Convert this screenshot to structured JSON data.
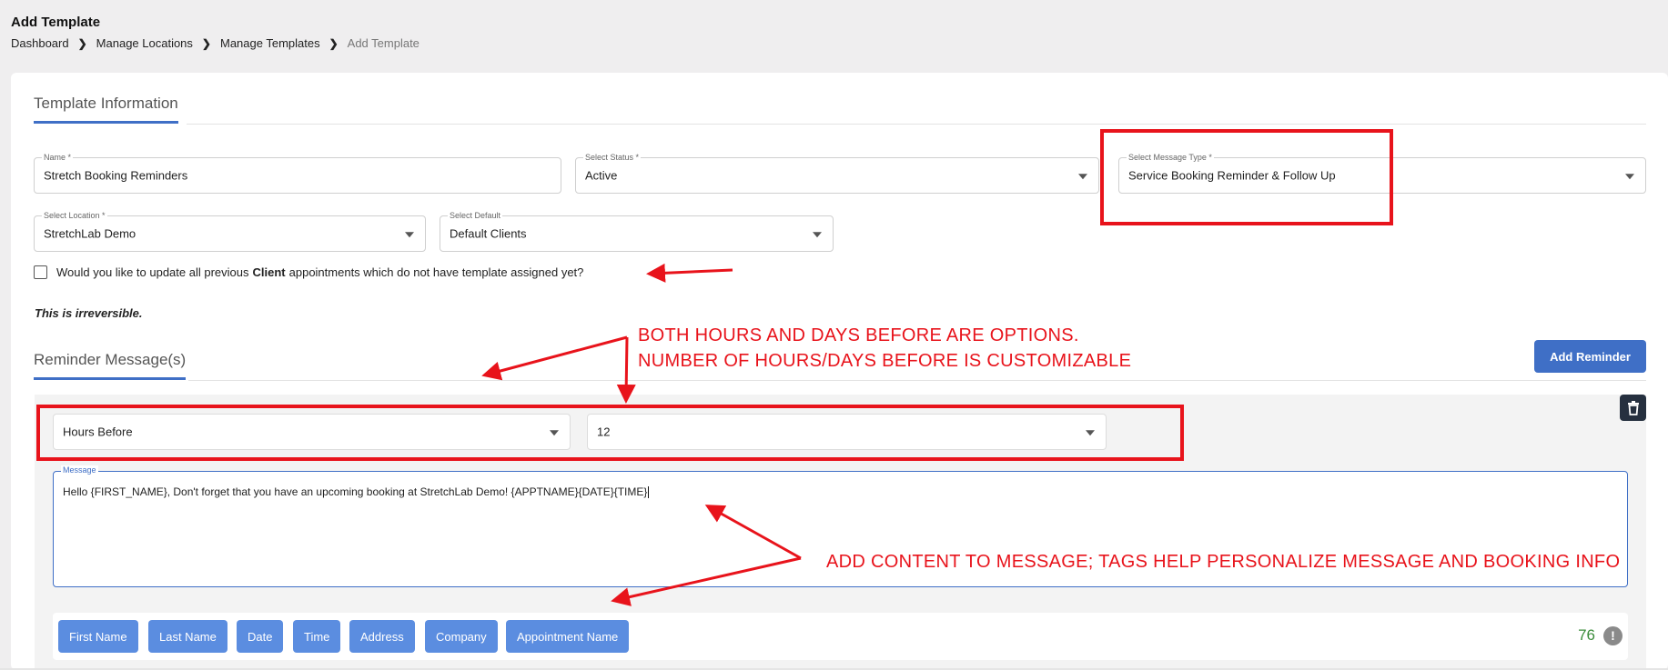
{
  "header": {
    "title": "Add Template",
    "breadcrumb": [
      "Dashboard",
      "Manage Locations",
      "Manage Templates",
      "Add Template"
    ]
  },
  "template_info": {
    "section_title": "Template Information",
    "name": {
      "label": "Name *",
      "value": "Stretch Booking Reminders"
    },
    "status": {
      "label": "Select Status *",
      "value": "Active"
    },
    "message_type": {
      "label": "Select Message Type *",
      "value": "Service Booking Reminder & Follow Up"
    },
    "location": {
      "label": "Select Location *",
      "value": "StretchLab Demo"
    },
    "default": {
      "label": "Select Default",
      "value": "Default Clients"
    },
    "update_checkbox": {
      "text_before": "Would you like to update all previous",
      "bold": "Client",
      "text_after": "appointments which do not have template assigned yet?"
    },
    "irreversible_note": "This is irreversible."
  },
  "reminders": {
    "section_title": "Reminder Message(s)",
    "add_button": "Add Reminder",
    "timing_type": "Hours Before",
    "timing_value": "12",
    "message": {
      "label": "Message",
      "value": "Hello {FIRST_NAME}, Don't forget that you have an upcoming booking at StretchLab Demo!  {APPTNAME}{DATE}{TIME}"
    },
    "tags": [
      "First Name",
      "Last Name",
      "Date",
      "Time",
      "Address",
      "Company",
      "Appointment Name"
    ],
    "char_count": "76",
    "info_icon": "!"
  },
  "annotations": {
    "timing_line1": "BOTH HOURS AND DAYS BEFORE ARE OPTIONS.",
    "timing_line2": "NUMBER OF HOURS/DAYS BEFORE IS CUSTOMIZABLE",
    "message_note": "ADD CONTENT TO MESSAGE; TAGS HELP PERSONALIZE MESSAGE AND BOOKING INFO"
  },
  "colors": {
    "accent": "#3f6fc6",
    "tag_button": "#5b8de0",
    "annotation_red": "#e8131b",
    "count_green": "#3b8c3b",
    "trash_bg": "#26303f"
  },
  "icons": {
    "breadcrumb_separator": "chevron-right-icon",
    "dropdown": "caret-down-icon",
    "delete": "trash-icon",
    "info": "info-icon"
  }
}
